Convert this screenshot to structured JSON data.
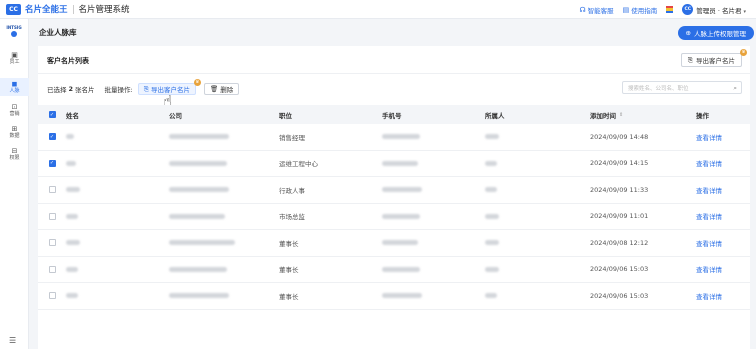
{
  "header": {
    "logo_text": "CC",
    "app_name": "名片全能王",
    "system_name": "名片管理系统",
    "links": [
      {
        "icon": "headset-icon",
        "glyph": "☊",
        "label": "智能客服"
      },
      {
        "icon": "book-icon",
        "glyph": "▤",
        "label": "使用指南"
      }
    ],
    "avatar_text": "CC",
    "admin_label": "管理员 · 名片君",
    "admin_caret": "▾"
  },
  "sidebar": {
    "logo_text": "INTSIG",
    "items": [
      {
        "icon": "staff-icon",
        "glyph": "▣",
        "label": "员工",
        "active": false
      },
      {
        "icon": "contacts-icon",
        "glyph": "◼",
        "label": "人脉",
        "active": true
      },
      {
        "icon": "marketing-icon",
        "glyph": "⊡",
        "label": "营销",
        "active": false
      },
      {
        "icon": "data-icon",
        "glyph": "⊞",
        "label": "数据",
        "active": false
      },
      {
        "icon": "permission-icon",
        "glyph": "⊟",
        "label": "权限",
        "active": false
      }
    ],
    "bottom_glyph": "☰"
  },
  "page": {
    "title": "企业人脉库",
    "upload_button": "人脉上传权限管理",
    "upload_glyph": "⊕"
  },
  "card": {
    "title": "客户名片列表",
    "export_button": "导出客户名片",
    "export_glyph": "⎘",
    "crown_glyph": "♛",
    "toolbar": {
      "selected_prefix": "已选择",
      "selected_count": "2",
      "selected_suffix": "张名片",
      "batch_label": "批量操作:",
      "export_selected": "导出客户名片",
      "delete": "删除",
      "delete_glyph": "🗑"
    },
    "search_placeholder": "搜索姓名、公司名、职位",
    "search_glyph": "⌕",
    "cursor_glyph": "☝"
  },
  "table": {
    "columns": [
      "姓名",
      "公司",
      "职位",
      "手机号",
      "所属人",
      "添加时间",
      "操作"
    ],
    "sort_glyph": "⇕",
    "rows": [
      {
        "checked": true,
        "position": "销售经理",
        "time": "2024/09/09 14:48",
        "action": "查看详情"
      },
      {
        "checked": true,
        "position": "运维工程中心",
        "time": "2024/09/09 14:15",
        "action": "查看详情"
      },
      {
        "checked": false,
        "position": "行政人事",
        "time": "2024/09/09 11:33",
        "action": "查看详情"
      },
      {
        "checked": false,
        "position": "市场总监",
        "time": "2024/09/09 11:01",
        "action": "查看详情"
      },
      {
        "checked": false,
        "position": "董事长",
        "time": "2024/09/08 12:12",
        "action": "查看详情"
      },
      {
        "checked": false,
        "position": "董事长",
        "time": "2024/09/06 15:03",
        "action": "查看详情"
      },
      {
        "checked": false,
        "position": "董事长",
        "time": "2024/09/06 15:03",
        "action": "查看详情"
      }
    ]
  },
  "colors": {
    "accent": "#2b6fe6",
    "crown": "#e8a33c"
  }
}
